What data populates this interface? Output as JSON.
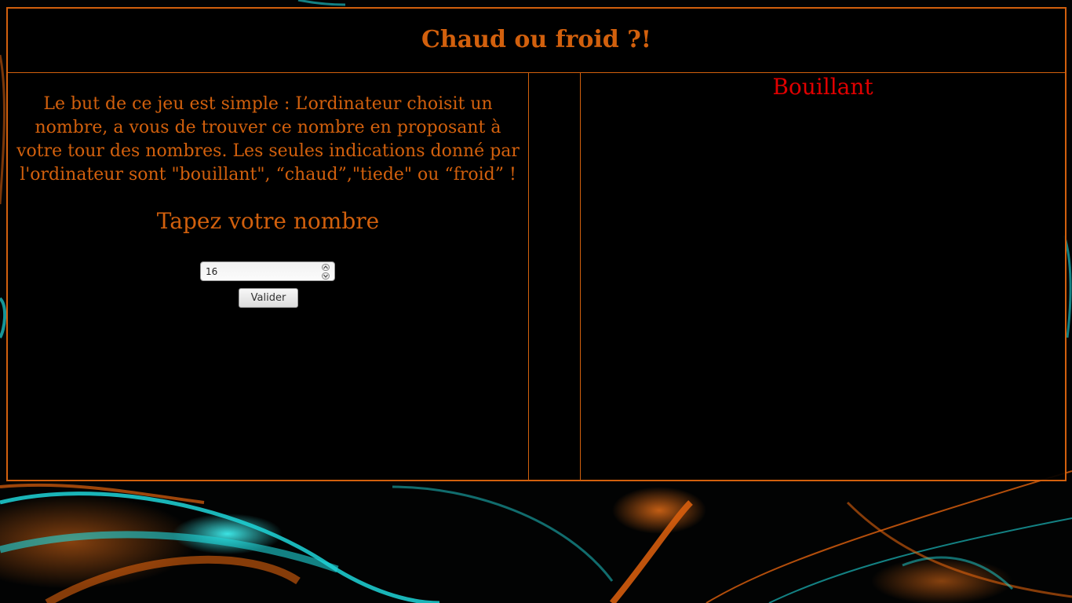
{
  "page": {
    "title": "Chaud ou froid ?!"
  },
  "rules": {
    "text": "Le but de ce jeu est simple : L’ordinateur choisit un nombre, a vous de trouver ce nombre en proposant à votre tour des nombres. Les seules indications donné par l'ordinateur sont \"bouillant\", “chaud”,\"tiede\" ou “froid” !"
  },
  "form": {
    "prompt_label": "Tapez votre nombre",
    "number_value": "16",
    "submit_label": "Valider"
  },
  "result": {
    "text": "Bouillant"
  },
  "colors": {
    "accent": "#d2600d",
    "result": "#e00000",
    "background": "#000000",
    "swirl_teal": "#1fd5d8",
    "swirl_orange": "#e0620e"
  }
}
